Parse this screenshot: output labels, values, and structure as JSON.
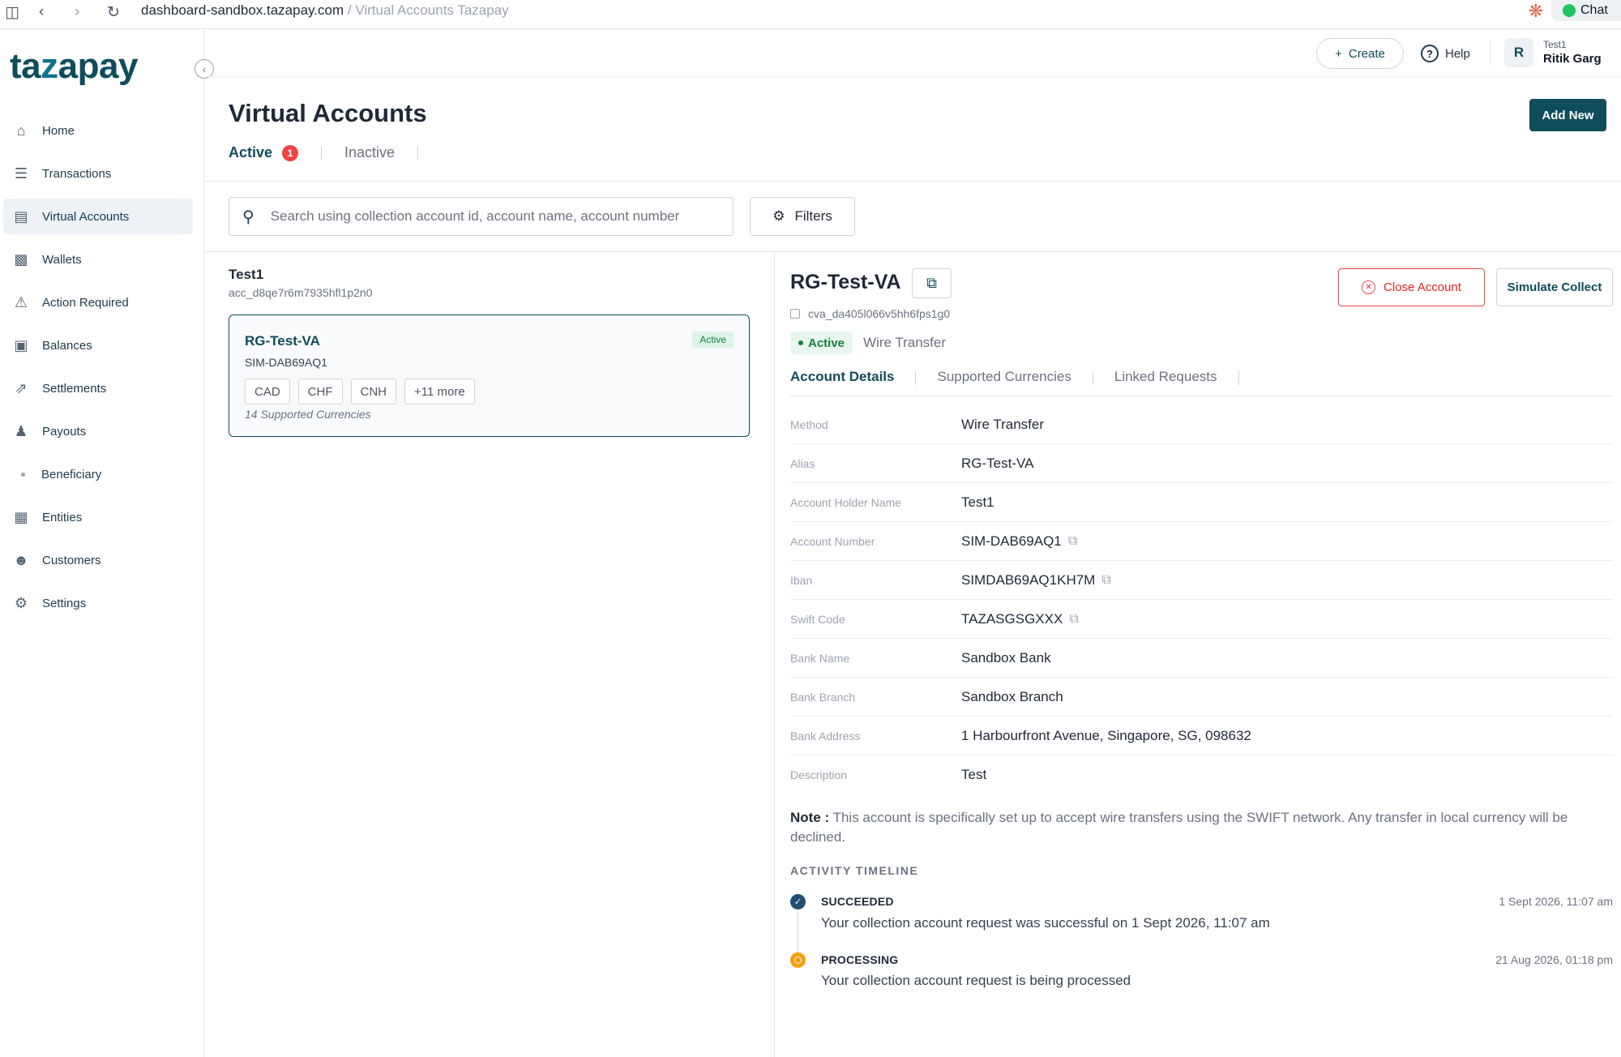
{
  "browser": {
    "url_host": "dashboard-sandbox.tazapay.com",
    "url_sep": "/",
    "page_title": "Virtual Accounts Tazapay",
    "chat_label": "Chat"
  },
  "brand": {
    "logo_pre": "ta",
    "logo_z": "z",
    "logo_post": "apay"
  },
  "sidebar": {
    "items": [
      {
        "label": "Home",
        "icon": "home-icon"
      },
      {
        "label": "Transactions",
        "icon": "list-icon"
      },
      {
        "label": "Virtual Accounts",
        "icon": "accounts-icon",
        "active": true
      },
      {
        "label": "Wallets",
        "icon": "wallet-icon"
      },
      {
        "label": "Action Required",
        "icon": "alert-icon"
      },
      {
        "label": "Balances",
        "icon": "bag-icon"
      },
      {
        "label": "Settlements",
        "icon": "arrow-out-icon"
      },
      {
        "label": "Payouts",
        "icon": "payout-user-icon"
      },
      {
        "label": "Beneficiary",
        "icon": "dot-icon"
      },
      {
        "label": "Entities",
        "icon": "document-icon"
      },
      {
        "label": "Customers",
        "icon": "user-icon"
      },
      {
        "label": "Settings",
        "icon": "gear-icon"
      }
    ]
  },
  "header": {
    "create_label": "Create",
    "help_label": "Help",
    "avatar_initial": "R",
    "user_org": "Test1",
    "user_name": "Ritik Garg"
  },
  "page": {
    "title": "Virtual Accounts",
    "add_new_label": "Add New",
    "tabs": [
      {
        "label": "Active",
        "badge": "1"
      },
      {
        "label": "Inactive"
      }
    ],
    "search_placeholder": "Search using collection account id, account name, account number",
    "filters_label": "Filters"
  },
  "list": {
    "group_title": "Test1",
    "group_id": "acc_d8qe7r6m7935hfl1p2n0",
    "card": {
      "name": "RG-Test-VA",
      "status": "Active",
      "account_number": "SIM-DAB69AQ1",
      "currencies": [
        "CAD",
        "CHF",
        "CNH",
        "+11 more"
      ],
      "supported_text": "14 Supported Currencies"
    }
  },
  "detail": {
    "title": "RG-Test-VA",
    "id": "cva_da405l066v5hh6fps1g0",
    "status": "Active",
    "method": "Wire Transfer",
    "close_label": "Close Account",
    "simulate_label": "Simulate Collect",
    "tabs": [
      "Account Details",
      "Supported Currencies",
      "Linked Requests"
    ],
    "fields": [
      {
        "label": "Method",
        "value": "Wire Transfer",
        "copy": false
      },
      {
        "label": "Alias",
        "value": "RG-Test-VA",
        "copy": false
      },
      {
        "label": "Account Holder Name",
        "value": "Test1",
        "copy": false
      },
      {
        "label": "Account Number",
        "value": "SIM-DAB69AQ1",
        "copy": true
      },
      {
        "label": "Iban",
        "value": "SIMDAB69AQ1KH7M",
        "copy": true
      },
      {
        "label": "Swift Code",
        "value": "TAZASGSGXXX",
        "copy": true
      },
      {
        "label": "Bank Name",
        "value": "Sandbox Bank",
        "copy": false
      },
      {
        "label": "Bank Branch",
        "value": "Sandbox Branch",
        "copy": false
      },
      {
        "label": "Bank Address",
        "value": "1 Harbourfront Avenue, Singapore, SG, 098632",
        "copy": false
      },
      {
        "label": "Description",
        "value": "Test",
        "copy": false
      }
    ],
    "note_label": "Note :",
    "note_text": "This account is specifically set up to accept wire transfers using the SWIFT network. Any transfer in local currency will be declined.",
    "activity_title": "ACTIVITY TIMELINE",
    "timeline": [
      {
        "status": "SUCCEEDED",
        "text": "Your collection account request was successful on 1 Sept 2026, 11:07 am",
        "time": "1 Sept 2026, 11:07 am"
      },
      {
        "status": "PROCESSING",
        "text": "Your collection account request is being processed",
        "time": "21 Aug 2026, 01:18 pm"
      }
    ]
  },
  "colors": {
    "brand": "#0f4c5c",
    "danger": "#ef4444",
    "success": "#15803d",
    "warning": "#f59e0b"
  }
}
